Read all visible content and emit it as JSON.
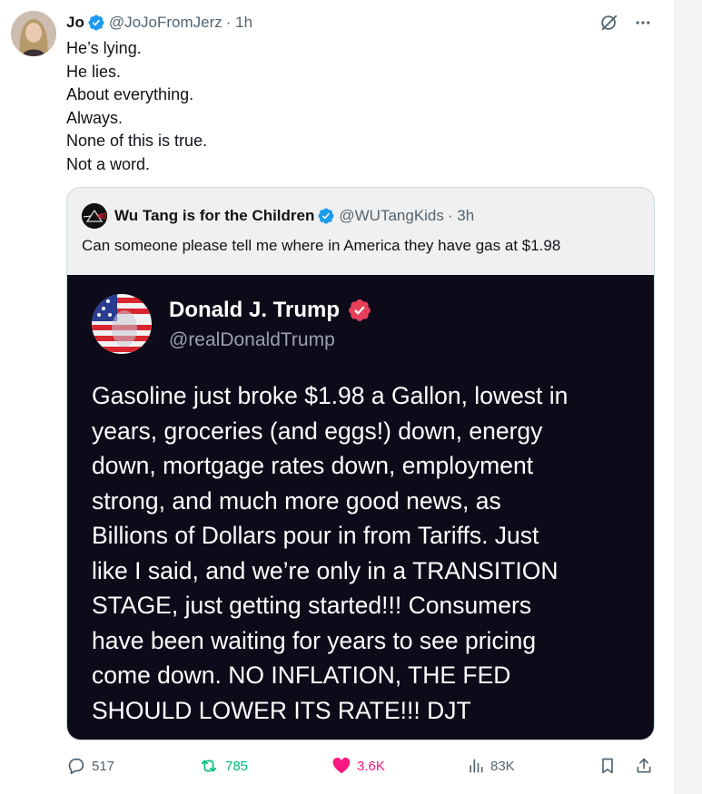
{
  "author": {
    "name": "Jo",
    "handle": "@JoJoFromJerz",
    "time": "· 1h"
  },
  "tweet": {
    "lines": [
      "He’s lying.",
      "He lies.",
      "About everything.",
      "Always.",
      "None of this is true.",
      "Not a word."
    ]
  },
  "quote": {
    "name": "Wu Tang is for the Children",
    "handle": "@WUTangKids",
    "time": "· 3h",
    "text": "Can someone please tell me where in America they have gas at $1.98"
  },
  "embedded_post": {
    "name": "Donald J. Trump",
    "handle": "@realDonaldTrump",
    "lines": [
      "Gasoline just broke $1.98 a Gallon, lowest in",
      "years, groceries (and eggs!) down, energy",
      "down, mortgage rates down, employment",
      "strong, and much more good news, as",
      "Billions of Dollars pour in from Tariffs. Just",
      "like I said, and we’re only in a TRANSITION",
      "STAGE, just getting started!!! Consumers",
      "have been waiting for years to see pricing",
      "come down. NO INFLATION, THE FED",
      "SHOULD LOWER ITS RATE!!! DJT"
    ]
  },
  "actions": {
    "replies": "517",
    "reposts": "785",
    "likes": "3.6K",
    "views": "83K"
  },
  "colors": {
    "verified_blue": "#1d9bf0",
    "repost_green": "#00ba7c",
    "like_pink": "#f91880",
    "truth_badge": "#e8405a",
    "card_bg": "#0d0b1a"
  },
  "icons": [
    "verified-badge-icon",
    "grok-icon",
    "more-icon",
    "reply-icon",
    "repost-icon",
    "heart-icon",
    "views-icon",
    "bookmark-icon",
    "share-icon"
  ]
}
